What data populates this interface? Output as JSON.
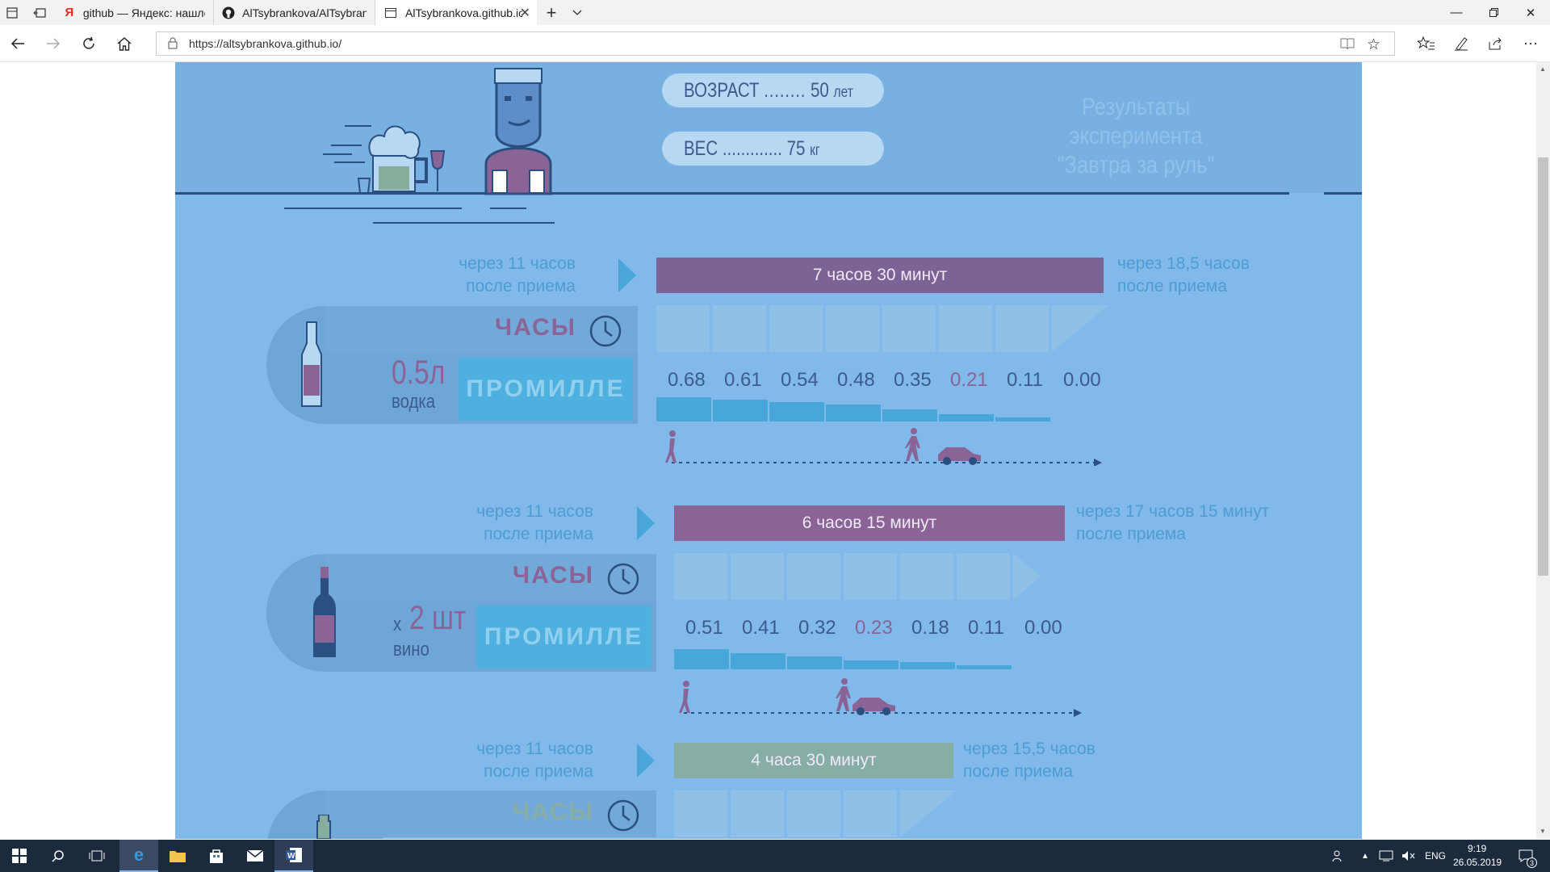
{
  "browser": {
    "tabs": [
      {
        "label": "github — Яндекс: нашлось",
        "icon": "yandex-icon"
      },
      {
        "label": "AlTsybrankova/AlTsybranko",
        "icon": "github-icon"
      },
      {
        "label": "AlTsybrankova.github.io",
        "icon": "page-icon"
      }
    ],
    "url": "https://altsybrankova.github.io/"
  },
  "header": {
    "age_label": "ВОЗРАСТ",
    "age_dots": "........",
    "age_value": "50",
    "age_unit": "лет",
    "weight_label": "ВЕС",
    "weight_dots": ".............",
    "weight_value": "75",
    "weight_unit": "кг",
    "title_line1": "Результаты эксперимента",
    "title_line2": "\"Завтра за руль\""
  },
  "sections": [
    {
      "note_left": [
        "через 11 часов",
        "после приема"
      ],
      "bar_label": "7 часов 30 минут",
      "bar_color": "#7b6396",
      "note_right": [
        "через 18,5 часов",
        "после приема"
      ],
      "hours_label": "ЧАСЫ",
      "promille_label": "ПРОМИЛЛЕ",
      "qty_big": "0.5л",
      "qty_small": "водка",
      "promille_values": [
        "0.68",
        "0.61",
        "0.54",
        "0.48",
        "0.35",
        "0.21",
        "0.11",
        "0.00"
      ],
      "promille_levels": [
        0.68,
        0.61,
        0.54,
        0.48,
        0.35,
        0.21,
        0.11,
        0.0
      ],
      "highlight_index": 5
    },
    {
      "note_left": [
        "через 11 часов",
        "после приема"
      ],
      "bar_label": "6 часов 15 минут",
      "bar_color": "#8a6497",
      "note_right": [
        "через 17 часов 15 минут",
        "после приема"
      ],
      "hours_label": "ЧАСЫ",
      "promille_label": "ПРОМИЛЛЕ",
      "qty_prefix": "x",
      "qty_big": "2 шт",
      "qty_small": "вино",
      "promille_values": [
        "0.51",
        "0.41",
        "0.32",
        "0.23",
        "0.18",
        "0.11",
        "0.00"
      ],
      "promille_levels": [
        0.51,
        0.41,
        0.32,
        0.23,
        0.18,
        0.11,
        0.0
      ],
      "highlight_index": 3
    },
    {
      "note_left": [
        "через 11 часов",
        "после приема"
      ],
      "bar_label": "4 часа 30 минут",
      "bar_color": "#86aea6",
      "note_right": [
        "через 15,5 часов",
        "после приема"
      ],
      "hours_label": "ЧАСЫ"
    }
  ],
  "taskbar": {
    "lang": "ENG",
    "time": "9:19",
    "date": "26.05.2019",
    "notifications": "3"
  }
}
